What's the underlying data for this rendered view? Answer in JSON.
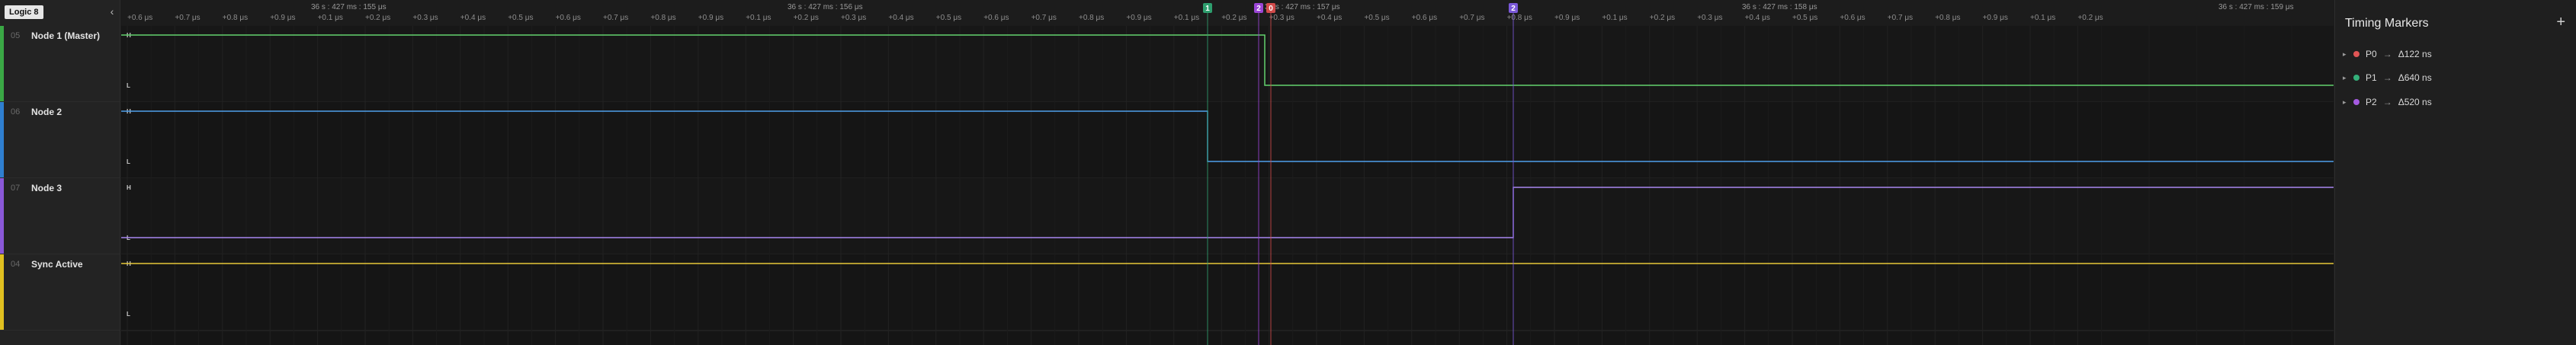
{
  "device": {
    "badge": "Logic 8",
    "collapse_icon": "chevron-left-icon"
  },
  "channels": [
    {
      "id": "05",
      "name": "Node 1 (Master)",
      "color": "#3aa845",
      "wave_color": "#63d46e",
      "high_label": "H",
      "low_label": "L"
    },
    {
      "id": "06",
      "name": "Node 2",
      "color": "#2f7fd0",
      "wave_color": "#4fa0ec",
      "high_label": "H",
      "low_label": "L"
    },
    {
      "id": "07",
      "name": "Node 3",
      "color": "#8a58d8",
      "wave_color": "#a987f0",
      "high_label": "H",
      "low_label": "L"
    },
    {
      "id": "04",
      "name": "Sync Active",
      "color": "#e0c020",
      "wave_color": "#e8c93a",
      "high_label": "H",
      "low_label": "L"
    }
  ],
  "timeline": {
    "reference_labels": [
      {
        "text": "36 s : 427 ms : 155 μs"
      },
      {
        "text": "36 s : 427 ms : 156 μs"
      },
      {
        "text": "36 s : 427 ms : 157 μs"
      },
      {
        "text": "36 s : 427 ms : 158 μs"
      },
      {
        "text": "36 s : 427 ms : 159 μs"
      }
    ],
    "tick_labels": [
      "+0.6 μs",
      "+0.7 μs",
      "+0.8 μs",
      "+0.9 μs",
      "+0.1 μs",
      "+0.2 μs",
      "+0.3 μs",
      "+0.4 μs",
      "+0.5 μs",
      "+0.6 μs",
      "+0.7 μs",
      "+0.8 μs",
      "+0.9 μs",
      "+0.1 μs",
      "+0.2 μs",
      "+0.3 μs",
      "+0.4 μs",
      "+0.5 μs",
      "+0.6 μs",
      "+0.7 μs",
      "+0.8 μs",
      "+0.9 μs",
      "+0.1 μs",
      "+0.2 μs",
      "+0.3 μs",
      "+0.4 μs",
      "+0.5 μs",
      "+0.6 μs",
      "+0.7 μs",
      "+0.8 μs",
      "+0.9 μs",
      "+0.1 μs",
      "+0.2 μs",
      "+0.3 μs",
      "+0.4 μs",
      "+0.5 μs",
      "+0.6 μs",
      "+0.7 μs",
      "+0.8 μs",
      "+0.9 μs",
      "+0.1 μs",
      "+0.2 μs"
    ]
  },
  "markers": [
    {
      "label": "1",
      "color": "#2e9e6e",
      "channel_edge": "Node 2"
    },
    {
      "label": "2",
      "color": "#9b45d6",
      "channel_edge": "Node 1 (Master)"
    },
    {
      "label": "0",
      "color": "#d14a4a",
      "channel_edge": "Node 1 (Master)"
    },
    {
      "label": "2",
      "color": "#7a58d8",
      "channel_edge": "Node 3"
    }
  ],
  "timing_panel": {
    "title": "Timing Markers",
    "add_icon": "plus-icon",
    "items": [
      {
        "name": "P0",
        "delta": "Δ122 ns",
        "color": "#e05555"
      },
      {
        "name": "P1",
        "delta": "Δ640 ns",
        "color": "#34b07a"
      },
      {
        "name": "P2",
        "delta": "Δ520 ns",
        "color": "#a45ae0"
      }
    ]
  }
}
